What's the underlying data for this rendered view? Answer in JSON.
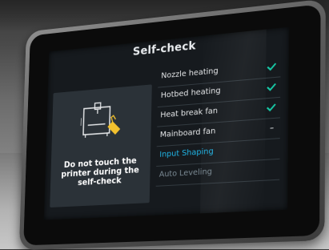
{
  "screen": {
    "title": "Self-check",
    "warning": "Do not touch the printer during the self-check"
  },
  "checks": [
    {
      "label": "Nozzle heating",
      "status": "done"
    },
    {
      "label": "Hotbed heating",
      "status": "done"
    },
    {
      "label": "Heat break fan",
      "status": "done"
    },
    {
      "label": "Mainboard fan",
      "status": "running"
    },
    {
      "label": "Input Shaping",
      "status": "pending"
    },
    {
      "label": "Auto Leveling",
      "status": "queued"
    }
  ],
  "colors": {
    "accent_blue": "#20b6e8",
    "check_green": "#17c9a6",
    "warning_yellow": "#f2c12e",
    "panel": "#2b3238",
    "screen_bg": "#161a1e"
  }
}
